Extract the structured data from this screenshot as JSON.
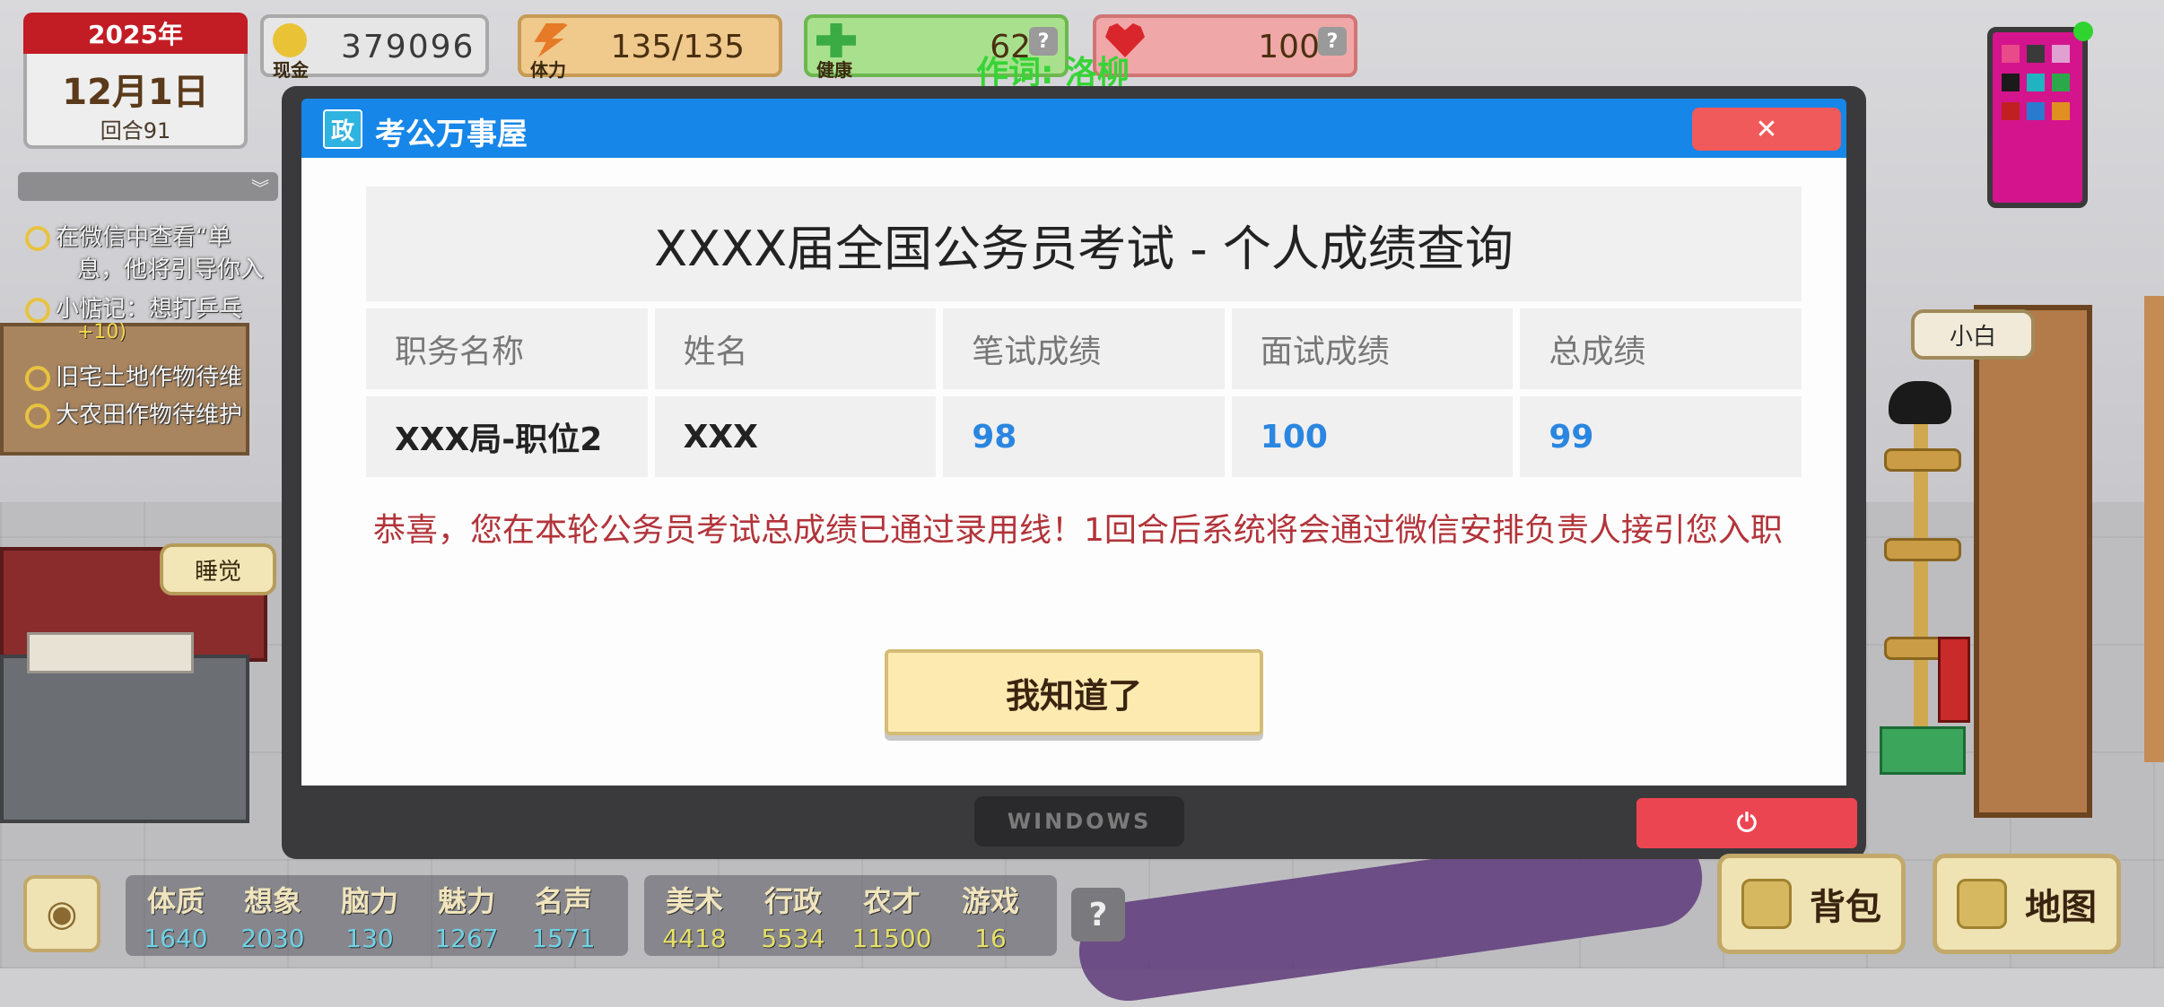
{
  "hud": {
    "year": "2025年",
    "date": "12月1日",
    "round": "回合91",
    "cash_label": "现金",
    "cash_value": "379096",
    "stamina_label": "体力",
    "stamina_value": "135/135",
    "health_label": "健康",
    "health_value": "62",
    "mood_value": "100",
    "help_glyph": "?"
  },
  "overlay_lyric": "作词: 洛柳",
  "tasks": {
    "collapse_glyph": "︾",
    "items": [
      "在微信中查看“单",
      "息，他将引导你入",
      "小惦记：想打乒乓",
      "旧宅土地作物待维",
      "大农田作物待维护"
    ],
    "bonus": "+10)"
  },
  "scene": {
    "sleep_label": "睡觉",
    "cat_name": "小白"
  },
  "dialog": {
    "icon_text": "政",
    "title": "考公万事屋",
    "close_glyph": "✕",
    "heading": "XXXX届全国公务员考试 - 个人成绩查询",
    "columns": [
      "职务名称",
      "姓名",
      "笔试成绩",
      "面试成绩",
      "总成绩"
    ],
    "row": [
      "XXX局-职位2",
      "XXX",
      "98",
      "100",
      "99"
    ],
    "notice": "恭喜，您在本轮公务员考试总成绩已通过录用线！1回合后系统将会通过微信安排负责人接引您入职",
    "ok_label": "我知道了",
    "footer_label": "WINDOWS",
    "power_glyph": "⏻"
  },
  "attributes": {
    "base": [
      {
        "name": "体质",
        "value": "1640"
      },
      {
        "name": "想象",
        "value": "2030"
      },
      {
        "name": "脑力",
        "value": "130"
      },
      {
        "name": "魅力",
        "value": "1267"
      },
      {
        "name": "名声",
        "value": "1571"
      }
    ],
    "skills": [
      {
        "name": "美术",
        "value": "4418"
      },
      {
        "name": "行政",
        "value": "5534"
      },
      {
        "name": "农才",
        "value": "11500"
      },
      {
        "name": "游戏",
        "value": "16"
      }
    ]
  },
  "bottom": {
    "eye_glyph": "◉",
    "help_glyph": "?",
    "bag_label": "背包",
    "map_label": "地图"
  },
  "colors": {
    "title_bar": "#1686e8",
    "close_button": "#f05a5a",
    "score_number": "#2a86e0",
    "notice_text": "#b2343a",
    "ok_button": "#fdeab0"
  }
}
